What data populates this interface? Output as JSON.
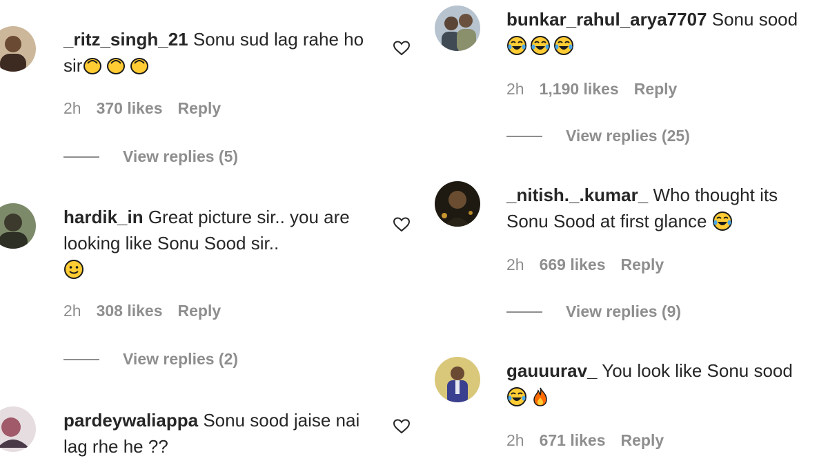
{
  "comments": [
    {
      "username": "_ritz_singh_21",
      "text": "Sonu sud lag rahe ho sir",
      "emoji": [
        "clapping-hands",
        "clapping-hands",
        "clapping-hands"
      ],
      "time": "2h",
      "likes": "370 likes",
      "reply": "Reply",
      "view_replies": "View replies (5)"
    },
    {
      "username": "hardik_in",
      "text": "Great picture sir.. you are looking like Sonu Sood sir..",
      "emoji": [
        "smiling-face"
      ],
      "time": "2h",
      "likes": "308 likes",
      "reply": "Reply",
      "view_replies": "View replies (2)"
    },
    {
      "username": "pardeywaliappa",
      "text": "Sonu sood jaise nai lag rhe he ??"
    },
    {
      "username": "bunkar_rahul_arya7707",
      "text": "Sonu sood",
      "emoji": [
        "tears-of-joy",
        "tears-of-joy",
        "tears-of-joy"
      ],
      "time": "2h",
      "likes": "1,190 likes",
      "reply": "Reply",
      "view_replies": "View replies (25)"
    },
    {
      "username": "_nitish._.kumar_",
      "text": "Who thought its Sonu Sood at first glance",
      "emoji": [
        "tears-of-joy"
      ],
      "time": "2h",
      "likes": "669 likes",
      "reply": "Reply",
      "view_replies": "View replies (9)"
    },
    {
      "username": "gauuurav_",
      "text": "You look like Sonu sood",
      "emoji": [
        "tears-of-joy",
        "fire"
      ],
      "time": "2h",
      "likes": "671 likes",
      "reply": "Reply"
    }
  ],
  "colors": {
    "text": "#262626",
    "muted": "#8e8e8e",
    "emoji_yellow": "#ffcc33",
    "emoji_outline": "#1a1a1a",
    "tear_blue": "#4aa8e8",
    "fire_orange": "#ff6a00"
  },
  "icons": {
    "like": "heart-outline-icon"
  }
}
